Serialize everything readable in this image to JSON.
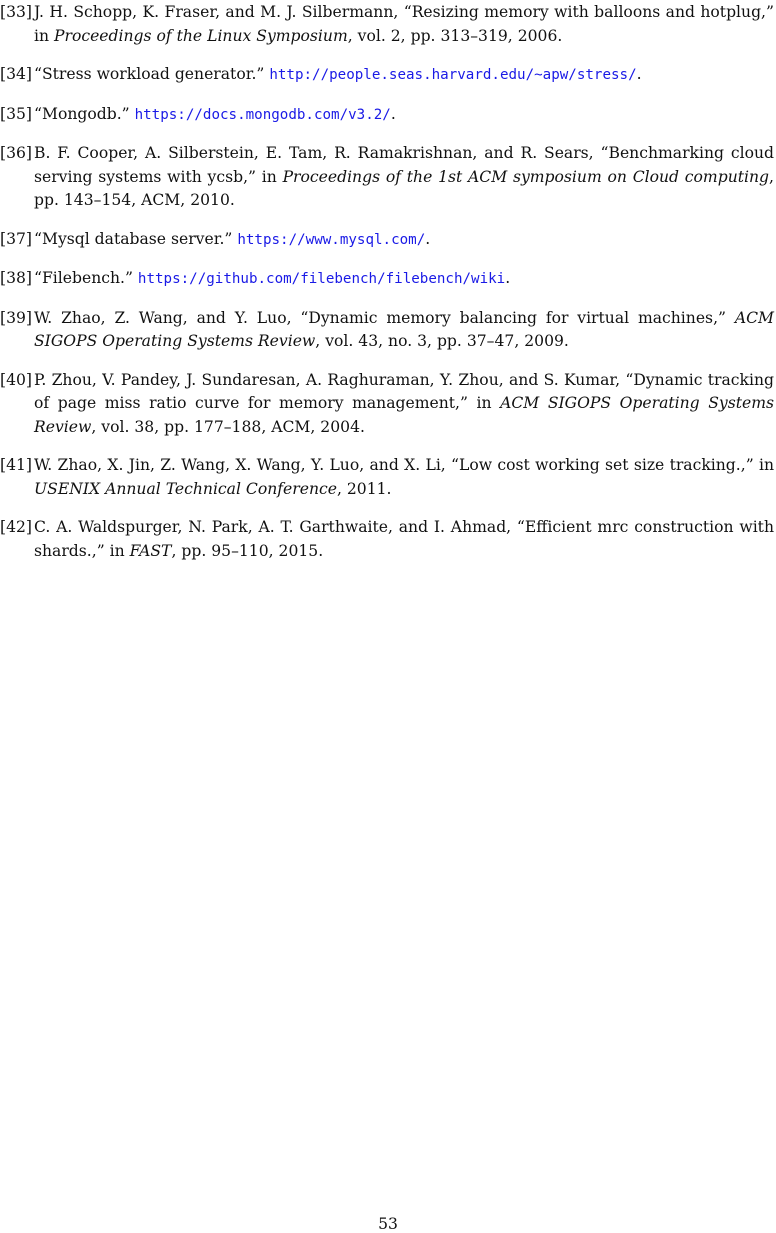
{
  "references": [
    {
      "number": "[33]",
      "pre": "J. H. Schopp, K. Fraser, and M. J. Silbermann, “Resizing memory with balloons and hotplug,” in ",
      "venue": "Proceedings of the Linux Symposium",
      "post": ", vol. 2, pp. 313–319, 2006."
    },
    {
      "number": "[34]",
      "pre": "“Stress workload generator.” ",
      "url": "http://people.seas.harvard.edu/~apw/stress/",
      "post": "."
    },
    {
      "number": "[35]",
      "pre": "“Mongodb.” ",
      "url": "https://docs.mongodb.com/v3.2/",
      "post": "."
    },
    {
      "number": "[36]",
      "pre": "B. F. Cooper, A. Silberstein, E. Tam, R. Ramakrishnan, and R. Sears, “Benchmarking cloud serving systems with ycsb,” in ",
      "venue": "Proceedings of the 1st ACM symposium on Cloud computing",
      "post": ", pp. 143–154, ACM, 2010."
    },
    {
      "number": "[37]",
      "pre": "“Mysql database server.” ",
      "url": "https://www.mysql.com/",
      "post": "."
    },
    {
      "number": "[38]",
      "pre": "“Filebench.” ",
      "url": "https://github.com/filebench/filebench/wiki",
      "post": "."
    },
    {
      "number": "[39]",
      "pre": "W. Zhao, Z. Wang, and Y. Luo, “Dynamic memory balancing for virtual machines,” ",
      "venue": "ACM SIGOPS Operating Systems Review",
      "post": ", vol. 43, no. 3, pp. 37–47, 2009."
    },
    {
      "number": "[40]",
      "pre": "P. Zhou, V. Pandey, J. Sundaresan, A. Raghuraman, Y. Zhou, and S. Kumar, “Dynamic tracking of page miss ratio curve for memory management,” in ",
      "venue": "ACM SIGOPS Operating Systems Review",
      "post": ", vol. 38, pp. 177–188, ACM, 2004."
    },
    {
      "number": "[41]",
      "pre": "W. Zhao, X. Jin, Z. Wang, X. Wang, Y. Luo, and X. Li, “Low cost working set size tracking.,” in ",
      "venue": "USENIX Annual Technical Conference",
      "post": ", 2011."
    },
    {
      "number": "[42]",
      "pre": "C. A. Waldspurger, N. Park, A. T. Garthwaite, and I. Ahmad, “Efficient mrc construction with shards.,” in ",
      "venue": "FAST",
      "post": ", pp. 95–110, 2015."
    }
  ],
  "page_number": "53",
  "colors": {
    "url": "#1a1ae6",
    "text": "#111111"
  }
}
